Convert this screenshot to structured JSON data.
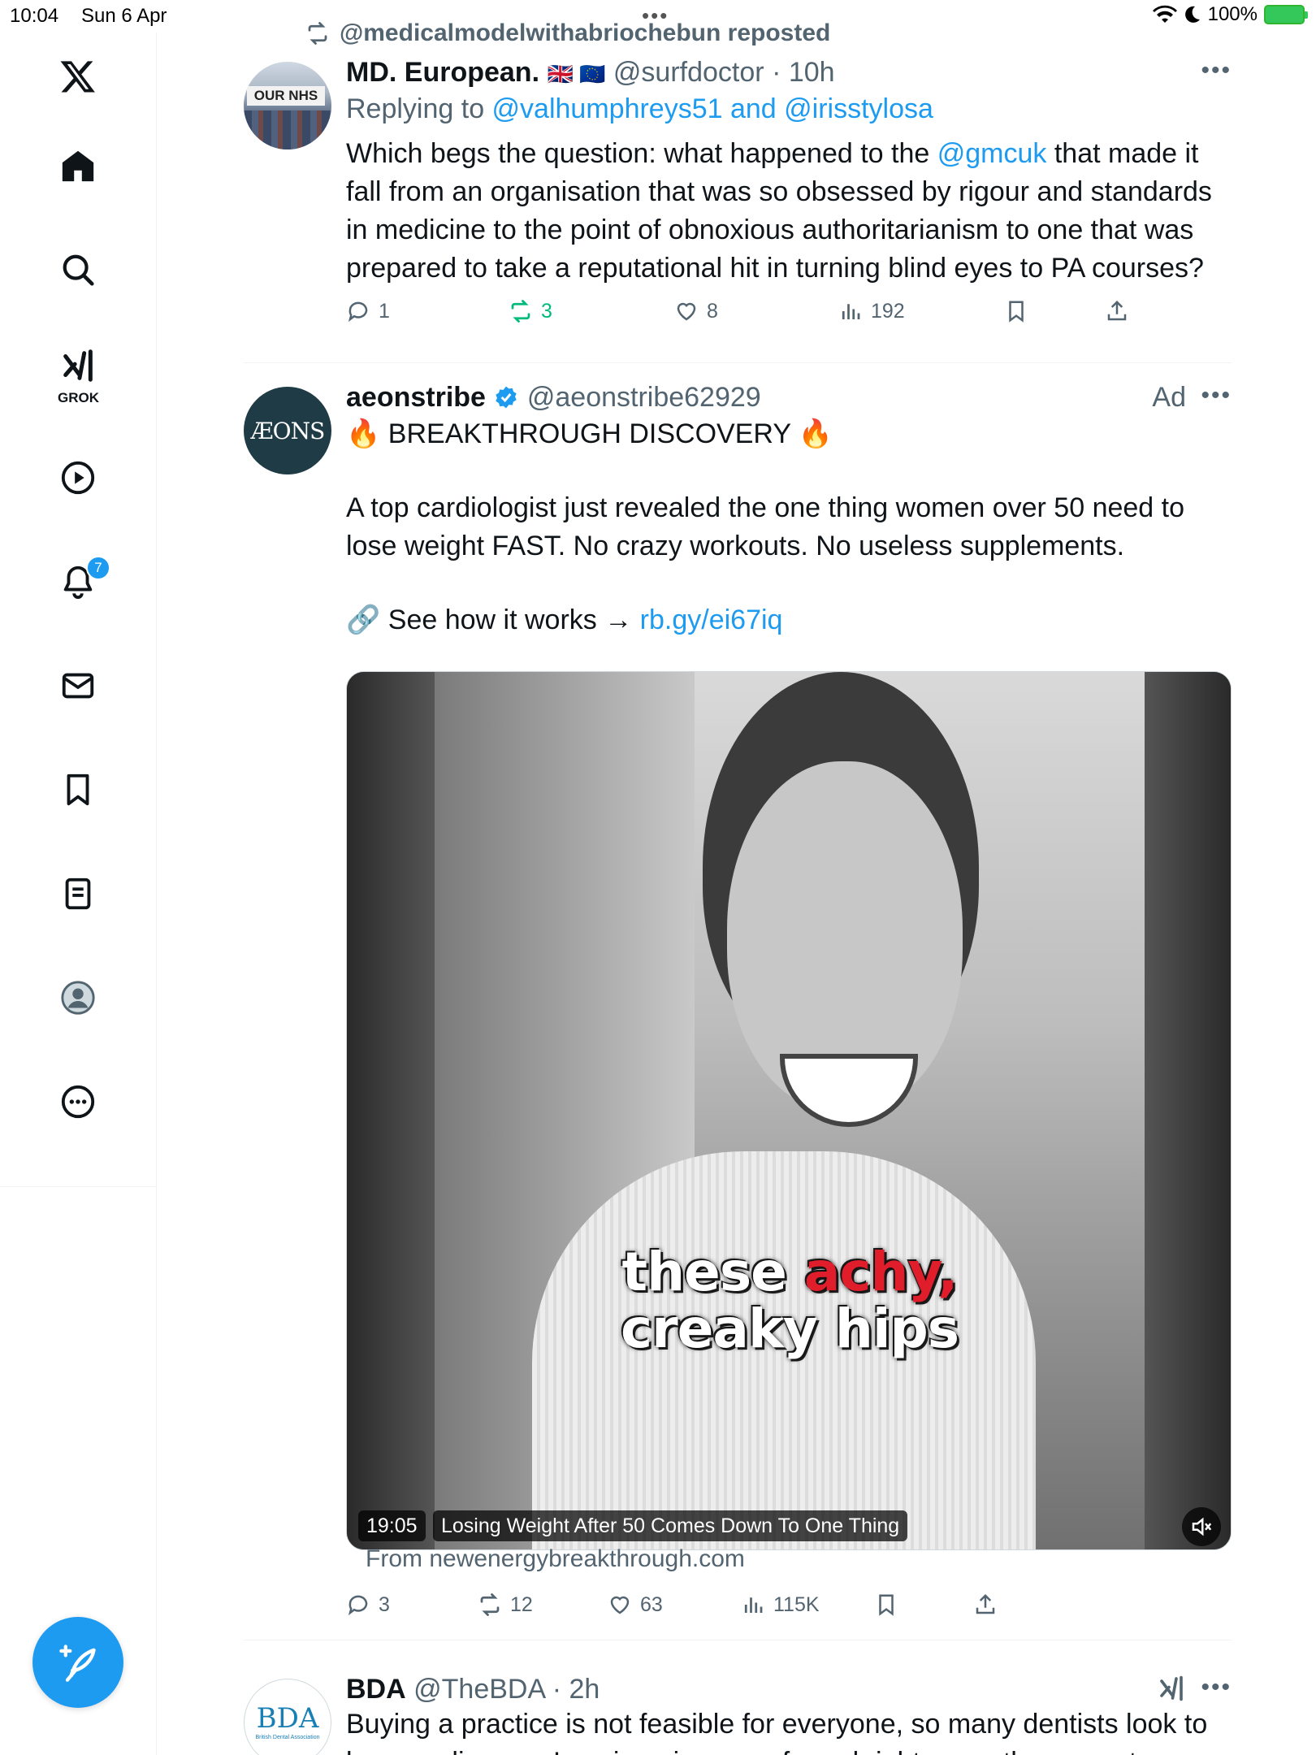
{
  "status_bar": {
    "time": "10:04",
    "date": "Sun 6 Apr",
    "battery": "100%"
  },
  "sidebar": {
    "grok_label": "GROK",
    "notification_count": "7"
  },
  "tweets": [
    {
      "repost_text": "@medicalmodelwithabriochebun reposted",
      "name": "MD. European.",
      "flags": "🇬🇧 🇪🇺",
      "handle": "@surfdoctor",
      "time": "10h",
      "replying_prefix": "Replying to ",
      "replying_users": "@valhumphreys51 and @irisstylosa",
      "avatar_banner": "OUR NHS",
      "text_before": "Which begs the question: what happened to the ",
      "mention": "@gmcuk",
      "text_after": " that made it fall from an organisation that was so obsessed by rigour and standards in medicine to the point of obnoxious authoritarianism to one that was prepared to take a reputational hit in turning blind eyes to PA courses?",
      "replies": "1",
      "reposts": "3",
      "likes": "8",
      "views": "192"
    },
    {
      "name": "aeonstribe",
      "handle": "@aeonstribe62929",
      "ad_label": "Ad",
      "avatar_text": "ÆONS",
      "headline": "🔥 BREAKTHROUGH DISCOVERY 🔥",
      "paragraph": "A top cardiologist just revealed the one thing women over 50 need to lose weight FAST. No crazy workouts. No useless supplements.",
      "cta_text": "🔗 See how it works → ",
      "cta_link": "rb.gy/ei67iq",
      "video_caption_1": "these ",
      "video_caption_red": "achy,",
      "video_caption_2": "creaky hips",
      "video_duration": "19:05",
      "video_title": "Losing Weight After 50 Comes Down To One Thing",
      "source": "From newenergybreakthrough.com",
      "replies": "3",
      "reposts": "12",
      "likes": "63",
      "views": "115K"
    },
    {
      "name": "BDA",
      "handle": "@TheBDA",
      "time": "2h",
      "avatar_text": "BDA",
      "avatar_subtext": "British Dental Association",
      "text": "Buying a practice is not feasible for everyone, so many dentists look to lease or license. Leasing gives you formal rights over the property"
    }
  ],
  "colors": {
    "accent": "#1d9bf0",
    "muted": "#536471",
    "repost_green": "#00ba7c",
    "divider": "#eff3f4"
  }
}
